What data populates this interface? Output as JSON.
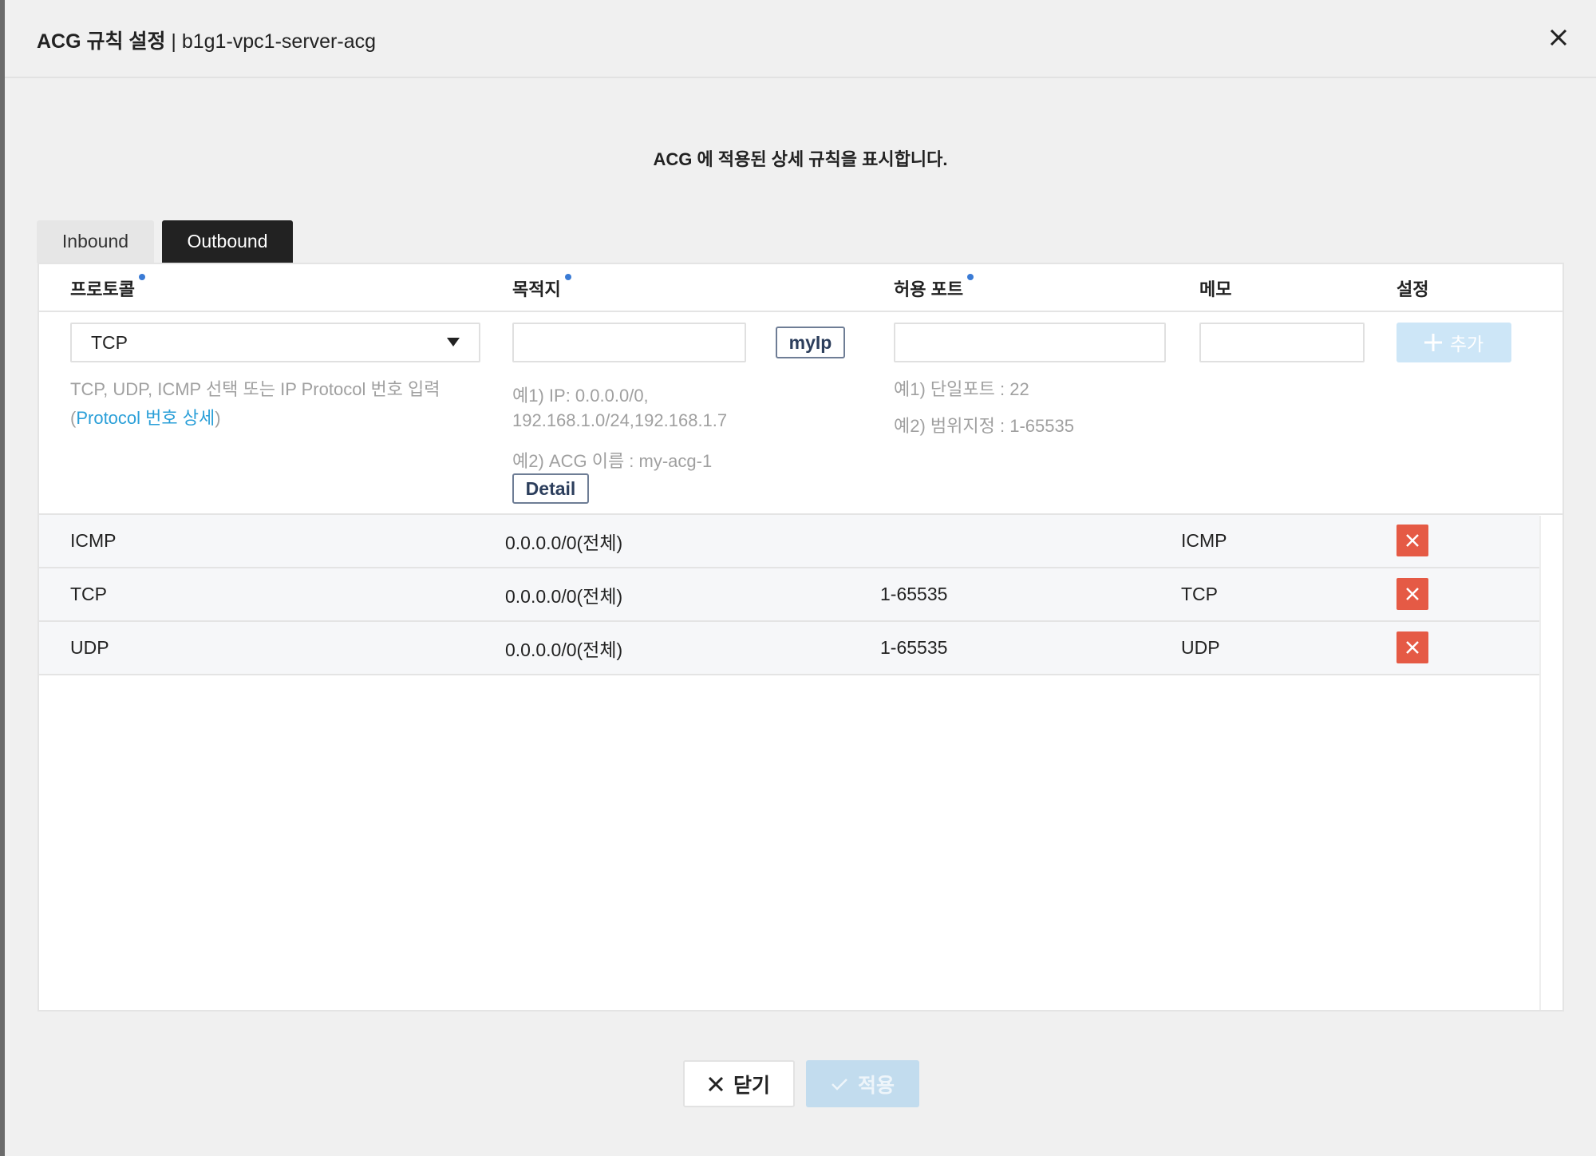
{
  "dialog": {
    "title_bold": "ACG 규칙 설정",
    "title_rest": " | b1g1-vpc1-server-acg",
    "close_icon": "close-icon"
  },
  "subtitle": "ACG 에 적용된 상세 규칙을 표시합니다.",
  "tabs": [
    {
      "label": "Inbound",
      "active": false
    },
    {
      "label": "Outbound",
      "active": true
    }
  ],
  "columns": [
    "프로토콜",
    "목적지",
    "허용 포트",
    "메모",
    "설정"
  ],
  "form": {
    "protocol_value": "TCP",
    "protocol_hint": "TCP, UDP, ICMP 선택 또는 IP Protocol 번호 입력",
    "protocol_link": "Protocol 번호 상세",
    "destination_value": "",
    "myip_label": "myIp",
    "dest_hint1": "예1) IP: 0.0.0.0/0,",
    "dest_hint2": "192.168.1.0/24,192.168.1.7",
    "dest_hint3": "예2) ACG 이름 : my-acg-1",
    "detail_label": "Detail",
    "port_value": "",
    "port_hint1": "예1) 단일포트 : 22",
    "port_hint2": "예2) 범위지정 : 1-65535",
    "memo_value": "",
    "add_label": "추가"
  },
  "rules": [
    {
      "protocol": "ICMP",
      "destination": "0.0.0.0/0(전체)",
      "port": "",
      "memo": "ICMP"
    },
    {
      "protocol": "TCP",
      "destination": "0.0.0.0/0(전체)",
      "port": "1-65535",
      "memo": "TCP"
    },
    {
      "protocol": "UDP",
      "destination": "0.0.0.0/0(전체)",
      "port": "1-65535",
      "memo": "UDP"
    }
  ],
  "footer": {
    "close_label": "닫기",
    "apply_label": "적용"
  },
  "colors": {
    "active_tab": "#222222",
    "required_dot": "#3a7bd5",
    "delete": "#e55a45",
    "disabled_primary": "#c2dcee",
    "link": "#2a9fd8"
  }
}
